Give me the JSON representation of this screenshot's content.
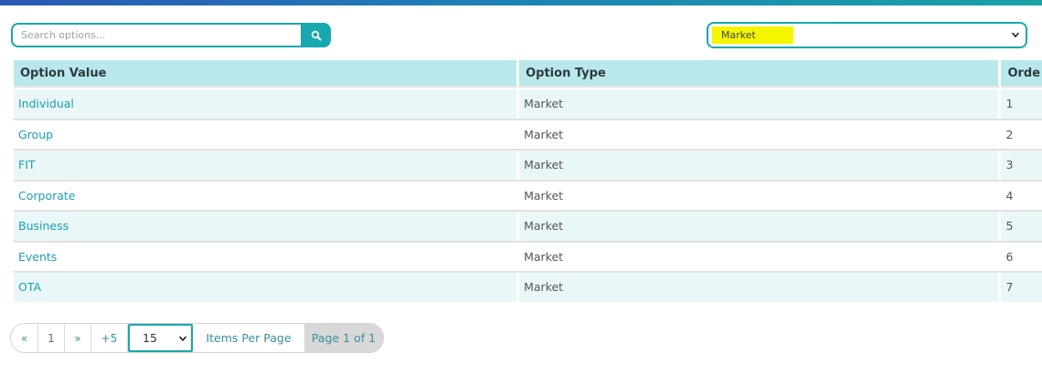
{
  "search": {
    "placeholder": "Search options..."
  },
  "filter": {
    "selected": "Market",
    "highlight_color": "#f5f500"
  },
  "table": {
    "columns": [
      "Option Value",
      "Option Type",
      "Orde"
    ],
    "rows": [
      [
        "Individual",
        "Market",
        "1"
      ],
      [
        "Group",
        "Market",
        "2"
      ],
      [
        "FIT",
        "Market",
        "3"
      ],
      [
        "Corporate",
        "Market",
        "4"
      ],
      [
        "Business",
        "Market",
        "5"
      ],
      [
        "Events",
        "Market",
        "6"
      ],
      [
        "OTA",
        "Market",
        "7"
      ]
    ]
  },
  "pagination": {
    "first": "«",
    "page": "1",
    "next": "»",
    "jump": "+5",
    "per_page": "15",
    "items_per_page_label": "Items Per Page",
    "page_of": "Page 1 of 1"
  },
  "colors": {
    "accent": "#17a8ad",
    "header_bg": "#b9e8ec",
    "row_alt_bg": "#eaf7f8",
    "link": "#1aa0b0"
  },
  "icons": {
    "search": "magnifier-icon",
    "select": "chevron-down-icon"
  }
}
